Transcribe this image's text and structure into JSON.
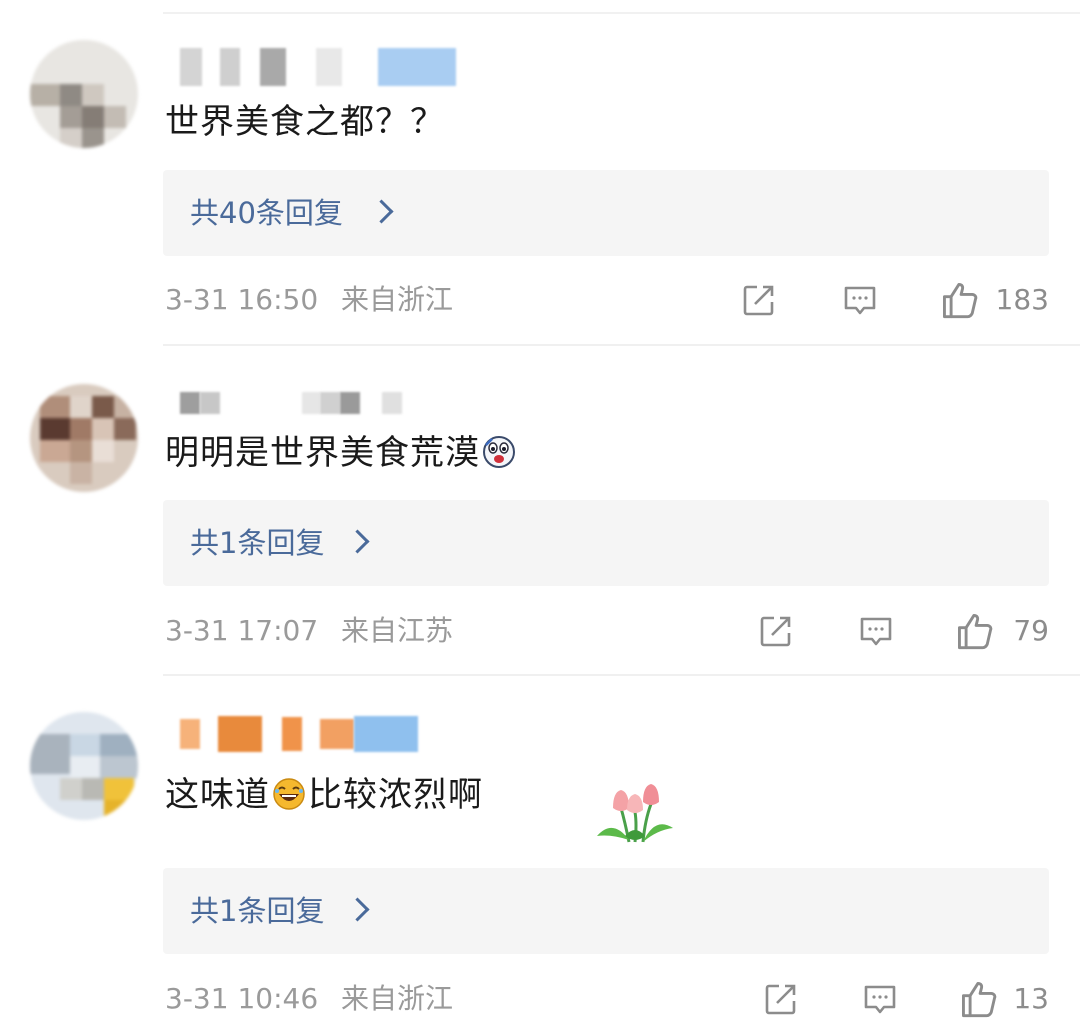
{
  "comments": [
    {
      "text": "世界美食之都？？",
      "replies_label": "共40条回复",
      "time": "3-31 16:50",
      "location": "来自浙江",
      "likes": "183"
    },
    {
      "text_before_emoji": "明明是世界美食荒漠",
      "emoji": "surprised-face-emoji",
      "replies_label": "共1条回复",
      "time": "3-31 17:07",
      "location": "来自江苏",
      "likes": "79"
    },
    {
      "text_before_emoji": "这味道",
      "emoji": "laughing-face-emoji",
      "text_after_emoji": "比较浓烈啊",
      "sticker": "tulip-sticker",
      "replies_label": "共1条回复",
      "time": "3-31 10:46",
      "location": "来自浙江",
      "likes": "13"
    }
  ],
  "icons": {
    "share": "share-icon",
    "reply": "comment-icon",
    "like": "thumbs-up-icon"
  },
  "colors": {
    "reply_link": "#4a6a9a",
    "meta_text": "#9a9a9a",
    "reply_panel": "#f5f5f5"
  }
}
